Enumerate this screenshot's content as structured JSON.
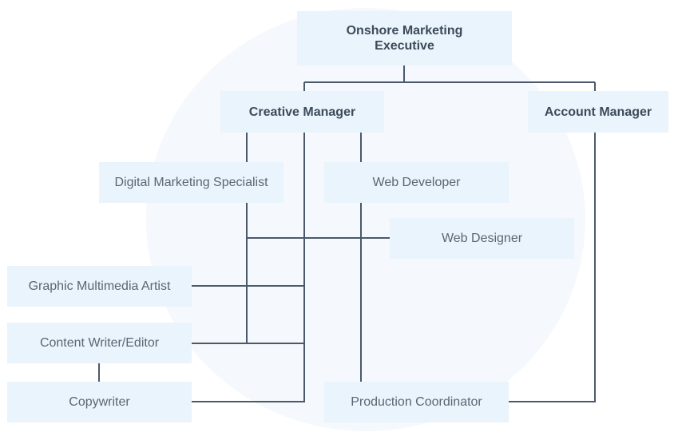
{
  "org_chart": {
    "root": {
      "label": "Onshore Marketing Executive"
    },
    "creative_manager": {
      "label": "Creative Manager"
    },
    "account_manager": {
      "label": "Account Manager"
    },
    "digital_marketing_specialist": {
      "label": "Digital Marketing Specialist"
    },
    "web_developer": {
      "label": "Web Developer"
    },
    "web_designer": {
      "label": "Web Designer"
    },
    "graphic_multimedia_artist": {
      "label": "Graphic Multimedia Artist"
    },
    "content_writer_editor": {
      "label": "Content Writer/Editor"
    },
    "copywriter": {
      "label": "Copywriter"
    },
    "production_coordinator": {
      "label": "Production Coordinator"
    }
  },
  "colors": {
    "box_fill": "#eaf4fc",
    "connector": "#4a5a6c",
    "background_circle": "#f5f8fc",
    "bold_text": "#3c4a5a",
    "text": "#5a6673"
  }
}
